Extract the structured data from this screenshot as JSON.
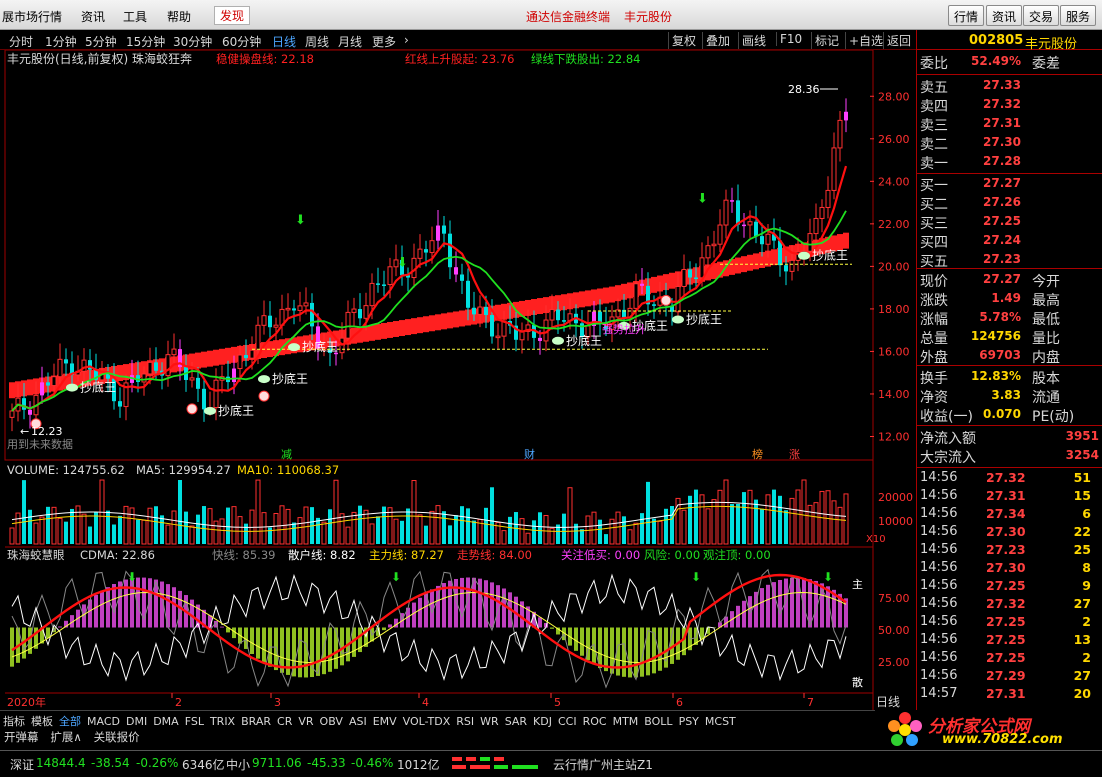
{
  "menu": {
    "items": [
      "展市场行情",
      "资讯",
      "工具",
      "帮助",
      "发现"
    ],
    "center_title": "通达信金融终端",
    "center_stock": "丰元股份",
    "right_buttons": [
      "行情",
      "资讯",
      "交易",
      "服务"
    ]
  },
  "period_tabs": [
    "分时",
    "1分钟",
    "5分钟",
    "15分钟",
    "30分钟",
    "60分钟",
    "日线",
    "周线",
    "月线",
    "更多"
  ],
  "active_period": "日线",
  "tool_buttons": [
    "复权",
    "叠加",
    "画线",
    "F10",
    "标记",
    "+自选",
    "返回"
  ],
  "main_chart": {
    "header_name": "丰元股份(日线,前复权) 珠海蛟狂奔",
    "legend": [
      {
        "label": "稳健操盘线: 22.18",
        "color": "#ff2020"
      },
      {
        "label": "红线上升股起: 23.76",
        "color": "#ff2020"
      },
      {
        "label": "绿线下跌股出: 22.84",
        "color": "#20e020"
      }
    ],
    "high_label": "28.36",
    "low_label": "12.23",
    "note_bottom": "用到未来数据",
    "events": [
      "减",
      "财",
      "榜",
      "涨"
    ],
    "signal_label": "抄底王",
    "rise_label": "强势拉升",
    "price_axis": [
      "28.00",
      "26.00",
      "24.00",
      "22.00",
      "20.00",
      "18.00",
      "16.00",
      "14.00",
      "12.00"
    ]
  },
  "volume_panel": {
    "title": "VOLUME: 124755.62",
    "ma5": "MA5: 129954.27",
    "ma10": "MA10: 110068.37",
    "axis": [
      "20000",
      "10000"
    ],
    "unit": "X10"
  },
  "cdma_panel": {
    "title": "珠海蛟慧眼",
    "cdma": "CDMA: 22.86",
    "fast": "快线: 85.39",
    "retail": "散户线: 8.82",
    "main": "主力线: 87.27",
    "trend": "走势线: 84.00",
    "buy": "关注低买: 0.00",
    "risk": "风险: 0.00",
    "top": "观注顶: 0.00",
    "axis": [
      "75.00",
      "50.00",
      "25.00"
    ],
    "side_labels": [
      "主",
      "散"
    ]
  },
  "time_axis": {
    "year": "2020年",
    "months": [
      "2",
      "3",
      "4",
      "5",
      "6",
      "7"
    ],
    "period": "日线"
  },
  "right_panel": {
    "code": "002805",
    "name": "丰元股份",
    "weibi_label": "委比",
    "weibi_value": "52.49%",
    "weicha_label": "委差",
    "asks": [
      {
        "label": "卖五",
        "price": "27.33"
      },
      {
        "label": "卖四",
        "price": "27.32"
      },
      {
        "label": "卖三",
        "price": "27.31"
      },
      {
        "label": "卖二",
        "price": "27.30"
      },
      {
        "label": "卖一",
        "price": "27.28"
      }
    ],
    "bids": [
      {
        "label": "买一",
        "price": "27.27"
      },
      {
        "label": "买二",
        "price": "27.26"
      },
      {
        "label": "买三",
        "price": "27.25"
      },
      {
        "label": "买四",
        "price": "27.24"
      },
      {
        "label": "买五",
        "price": "27.23"
      }
    ],
    "stats": [
      {
        "l": "现价",
        "v": "27.27",
        "r": "今开",
        "color": "#ff4040"
      },
      {
        "l": "涨跌",
        "v": "1.49",
        "r": "最高",
        "color": "#ff4040"
      },
      {
        "l": "涨幅",
        "v": "5.78%",
        "r": "最低",
        "color": "#ff4040"
      },
      {
        "l": "总量",
        "v": "124756",
        "r": "量比",
        "color": "#ffd700"
      },
      {
        "l": "外盘",
        "v": "69703",
        "r": "内盘",
        "color": "#ff4040"
      }
    ],
    "stats2": [
      {
        "l": "换手",
        "v": "12.83%",
        "r": "股本",
        "color": "#ffd700"
      },
      {
        "l": "净资",
        "v": "3.83",
        "r": "流通",
        "color": "#ffd700"
      },
      {
        "l": "收益(一)",
        "v": "0.070",
        "r": "PE(动)",
        "color": "#ffd700"
      }
    ],
    "flows": [
      {
        "l": "净流入额",
        "v": "3951"
      },
      {
        "l": "大宗流入",
        "v": "3254"
      }
    ],
    "ticks": [
      {
        "t": "14:56",
        "p": "27.32",
        "q": "51"
      },
      {
        "t": "14:56",
        "p": "27.31",
        "q": "15"
      },
      {
        "t": "14:56",
        "p": "27.34",
        "q": "6"
      },
      {
        "t": "14:56",
        "p": "27.30",
        "q": "22"
      },
      {
        "t": "14:56",
        "p": "27.23",
        "q": "25"
      },
      {
        "t": "14:56",
        "p": "27.30",
        "q": "8"
      },
      {
        "t": "14:56",
        "p": "27.25",
        "q": "9"
      },
      {
        "t": "14:56",
        "p": "27.32",
        "q": "27"
      },
      {
        "t": "14:56",
        "p": "27.25",
        "q": "2"
      },
      {
        "t": "14:56",
        "p": "27.25",
        "q": "13"
      },
      {
        "t": "14:56",
        "p": "27.25",
        "q": "2"
      },
      {
        "t": "14:56",
        "p": "27.29",
        "q": "27"
      },
      {
        "t": "14:57",
        "p": "27.31",
        "q": "20"
      }
    ]
  },
  "indicator_tabs": [
    "指标",
    "模板",
    "全部",
    "MACD",
    "DMI",
    "DMA",
    "FSL",
    "TRIX",
    "BRAR",
    "CR",
    "VR",
    "OBV",
    "ASI",
    "EMV",
    "VOL-TDX",
    "RSI",
    "WR",
    "SAR",
    "KDJ",
    "CCI",
    "ROC",
    "MTM",
    "BOLL",
    "PSY",
    "MCST"
  ],
  "active_indicator": "全部",
  "control_tabs": [
    "开弹幕",
    "扩展∧",
    "关联报价"
  ],
  "logo": {
    "line1": "分析家公式网",
    "line2": "www.70822.com"
  },
  "status": {
    "sz_label": "深证",
    "sz_value": "14844.4",
    "sz_change": "-38.54",
    "sz_pct": "-0.26%",
    "sz_amount": "6346亿",
    "zx_label": "中小",
    "zx_value": "9711.06",
    "zx_change": "-45.33",
    "zx_pct": "-0.46%",
    "zx_amount": "1012亿",
    "server": "云行情广州主站Z1"
  },
  "colors": {
    "up": "#ff3030",
    "down": "#00e0e0",
    "ma_red": "#ff1010",
    "ma_green": "#20e020",
    "band": "#ff2020",
    "purple": "#ff40ff",
    "gold": "#ffd700"
  }
}
